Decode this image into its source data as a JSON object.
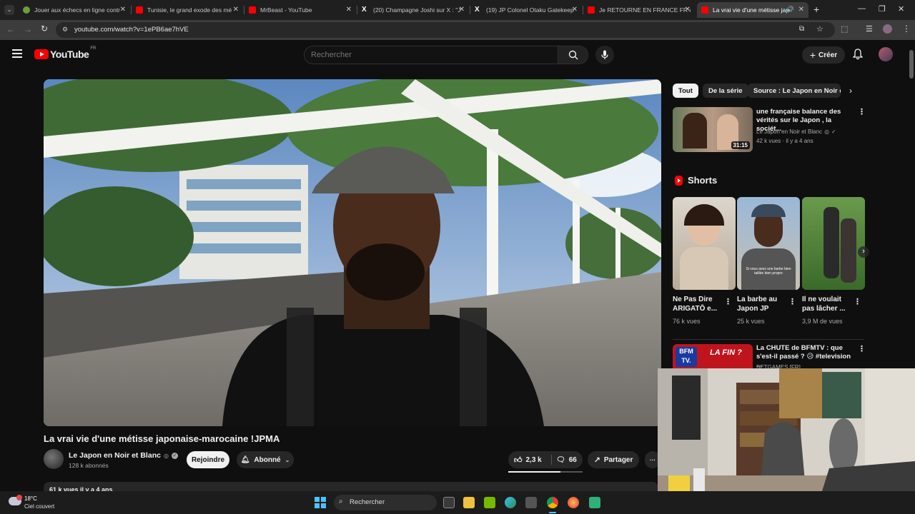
{
  "browser": {
    "tabs": [
      {
        "title": "Jouer aux échecs en ligne contr",
        "color": "#6f9d3c"
      },
      {
        "title": "Tunisie, le grand exode des mé",
        "color": "#ff0000"
      },
      {
        "title": "MrBeast - YouTube",
        "color": "#ff0000"
      },
      {
        "title": "(20) Champagne Joshi sur X : \"J",
        "color": "#ffffff"
      },
      {
        "title": "(19) JP Colonel Otaku Gatekeep",
        "color": "#ffffff"
      },
      {
        "title": "Je RETOURNE EN FRANCE FR au",
        "color": "#ff0000"
      },
      {
        "title": "La vrai vie d'une métisse jap",
        "color": "#ff0000"
      }
    ],
    "new_tab_label": "+",
    "url": "youtube.com/watch?v=1ePB6ae7hVE"
  },
  "youtube": {
    "logo_text": "YouTube",
    "region": "FR",
    "search_placeholder": "Rechercher",
    "create_label": "Créer"
  },
  "video": {
    "title": "La vrai vie d'une métisse japonaise-marocaine !JPMA",
    "channel_name": "Le Japon en Noir et Blanc",
    "subscribers": "128 k abonnés",
    "join_label": "Rejoindre",
    "subscribed_label": "Abonné",
    "likes": "2,3 k",
    "comments": "66",
    "share_label": "Partager",
    "more_label": "···",
    "description_stats": "61 k vues  il y a 4 ans"
  },
  "sidebar": {
    "chips": [
      "Tout",
      "De la série",
      "Source : Le Japon en Noir et"
    ],
    "related": [
      {
        "title": "une française balance des vérités sur le Japon , la sociét...",
        "channel": "Le Japon en Noir et Blanc",
        "meta": "42 k vues · il y a 4 ans",
        "duration": "31:15"
      },
      {
        "title": "La CHUTE de BFMTV : que s'est-il passé ? 😥 #television ...",
        "channel": "BETGAMES [FR]",
        "meta": "",
        "duration": ""
      }
    ],
    "shorts_label": "Shorts",
    "shorts": [
      {
        "title": "Ne Pas Dire ARIGATŌ e...",
        "views": "76 k vues"
      },
      {
        "title": "La barbe au Japon JP",
        "views": "25 k vues"
      },
      {
        "title": "Il ne voulait pas lâcher ...",
        "views": "3,9 M de vues"
      }
    ]
  },
  "taskbar": {
    "weather_temp": "18°C",
    "weather_desc": "Ciel couvert",
    "search_label": "Rechercher"
  },
  "overlay_text": {
    "short2_caption": "Si vous avez une barbe bien taillée bien propre",
    "thumb_badge": "BFM TV.",
    "thumb_banner": "LA FIN ?"
  }
}
